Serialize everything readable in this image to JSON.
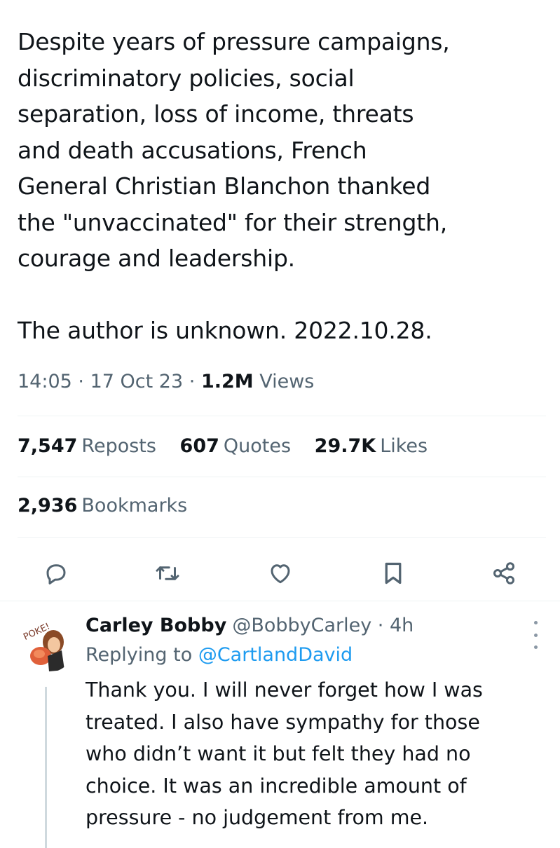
{
  "tweet": {
    "text": "Despite years of pressure campaigns,\ndiscriminatory policies, social\nseparation, loss of income, threats\nand death accusations, French\nGeneral Christian Blanchon thanked\nthe \"unvaccinated\" for their strength,\ncourage and leadership.",
    "text2": "The author is unknown. 2022.10.28.",
    "time": "14:05",
    "date": "17 Oct 23",
    "views_count": "1.2M",
    "views_label": "Views",
    "separator": "·"
  },
  "stats": {
    "reposts_count": "7,547",
    "reposts_label": "Reposts",
    "quotes_count": "607",
    "quotes_label": "Quotes",
    "likes_count": "29.7K",
    "likes_label": "Likes",
    "bookmarks_count": "2,936",
    "bookmarks_label": "Bookmarks"
  },
  "actions": {
    "icons": [
      "reply-icon",
      "repost-icon",
      "like-icon",
      "bookmark-icon",
      "share-icon"
    ],
    "icon_color": "#536471"
  },
  "reply": {
    "name": "Carley Bobby",
    "handle": "@BobbyCarley",
    "separator": "·",
    "age": "4h",
    "replying_prefix": "Replying to",
    "replying_to": "@CartlandDavid",
    "text": "Thank you. I will never forget how I was\ntreated. I also have sympathy for those\nwho didn’t want it but felt they had no\nchoice. It was an incredible amount of\npressure - no judgement from me.",
    "avatar_text": "POKE!"
  },
  "colors": {
    "text": "#0f1419",
    "secondary": "#536471",
    "link": "#1d9bf0",
    "divider": "#eff3f4"
  }
}
